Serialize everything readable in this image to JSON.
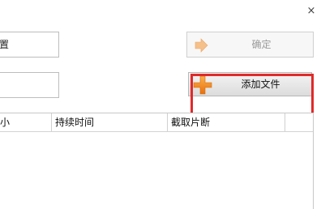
{
  "window": {
    "close_glyph": "×"
  },
  "form": {
    "top_field_text": "置",
    "second_field_text": ""
  },
  "buttons": {
    "confirm_label": "确定",
    "add_file_label": "添加文件"
  },
  "table": {
    "columns": [
      "小",
      "持续时间",
      "截取片断"
    ]
  },
  "colors": {
    "highlight": "#e02a2a",
    "add_icon": "#f08a1c",
    "confirm_icon": "#f5c08a"
  },
  "icons": {
    "confirm": "arrow-right-icon",
    "add_file": "plus-icon"
  }
}
